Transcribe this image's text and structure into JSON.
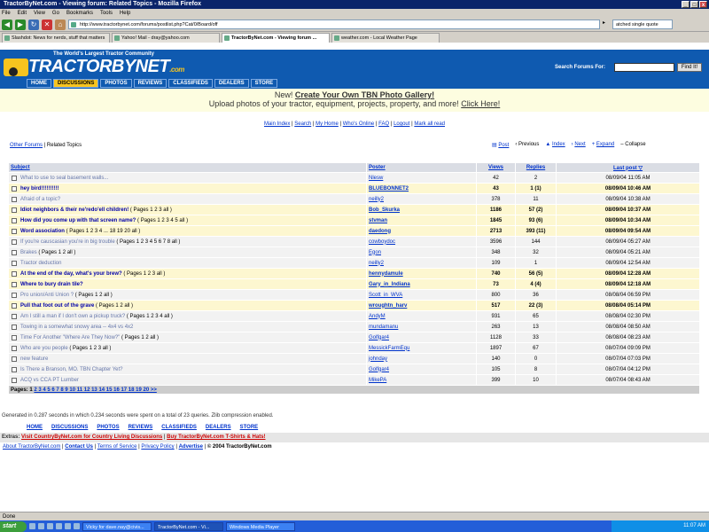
{
  "window": {
    "title": "TractorByNet.com - Viewing forum: Related Topics - Mozilla Firefox"
  },
  "menu": [
    "File",
    "Edit",
    "View",
    "Go",
    "Bookmarks",
    "Tools",
    "Help"
  ],
  "browser": {
    "url": "http://www.tractorbynet.com/forums/postlist.php?Cat/0/Board/off",
    "search": "atched single quote"
  },
  "tabs": [
    "Slashdot: News for nerds, stuff that matters",
    "Yahoo! Mail - dray@yahoo.com",
    "TractorByNet.com - Viewing forum ...",
    "weather.com - Local Weather Page"
  ],
  "site": {
    "slogan": "The World's Largest Tractor Community",
    "logo": "TRACTORBYNET",
    ".com": ".com",
    "search_label": "Search Forums For:",
    "find_btn": "Find It!",
    "nav": [
      "HOME",
      "DISCUSSIONS",
      "PHOTOS",
      "REVIEWS",
      "CLASSIFIEDS",
      "DEALERS",
      "STORE"
    ]
  },
  "promo": {
    "new": "New!",
    "headline": "Create Your Own TBN Photo Gallery!",
    "line2": "Upload photos of your tractor, equipment, projects, property, and more!",
    "click": "Click Here!"
  },
  "toplinks": [
    "Main Index",
    "Search",
    "My Home",
    "Who's Online",
    "FAQ",
    "Logout",
    "Mark all read"
  ],
  "crumb": {
    "other": "Other Forums",
    "current": "Related Topics"
  },
  "topicnav": [
    "Post",
    "Previous",
    "Index",
    "Next",
    "Expand",
    "Collapse"
  ],
  "columns": {
    "subject": "Subject",
    "poster": "Poster",
    "views": "Views",
    "replies": "Replies",
    "lastpost": "Last post ▽"
  },
  "rows": [
    {
      "s": "What to use to seal basement walls...",
      "pages": "",
      "p": "Nlesw",
      "v": "42",
      "r": "2",
      "t": "08/09/04 11:05 AM",
      "hot": false
    },
    {
      "s": "hey bird!!!!!!!!!!",
      "pages": "",
      "p": "BLUEBONNET2",
      "v": "43",
      "r": "1 (1)",
      "t": "08/09/04 10:46 AM",
      "hot": true
    },
    {
      "s": "Afraid of a topic?",
      "pages": "",
      "p": "neilly2",
      "v": "378",
      "r": "11",
      "t": "08/09/04 10:38 AM",
      "hot": false
    },
    {
      "s": "Idiot neighbors & their ne'redo'ell children!",
      "pages": "( Pages 1 2 3 all )",
      "p": "Bob_Skurka",
      "v": "1186",
      "r": "57 (2)",
      "t": "08/09/04 10:37 AM",
      "hot": true
    },
    {
      "s": "How did you come up with that screen name?",
      "pages": "( Pages 1 2 3 4 5 all )",
      "p": "stvman",
      "v": "1845",
      "r": "93 (6)",
      "t": "08/09/04 10:34 AM",
      "hot": true
    },
    {
      "s": "Word association",
      "pages": "( Pages 1 2 3 4 ... 18 19 20 all )",
      "p": "daedong",
      "v": "2713",
      "r": "393 (11)",
      "t": "08/09/04 09:54 AM",
      "hot": true
    },
    {
      "s": "If you're causcasian you're in big trouble",
      "pages": "( Pages 1 2 3 4 5 6 7 8 all )",
      "p": "cowboydoc",
      "v": "3596",
      "r": "144",
      "t": "08/09/04 05:27 AM",
      "hot": false
    },
    {
      "s": "Brakes",
      "pages": "( Pages 1 2 all )",
      "p": "Egon",
      "v": "348",
      "r": "32",
      "t": "08/09/04 05:21 AM",
      "hot": false
    },
    {
      "s": "Tractor deduction",
      "pages": "",
      "p": "neilly2",
      "v": "109",
      "r": "1",
      "t": "08/09/04 12:54 AM",
      "hot": false
    },
    {
      "s": "At the end of the day, what's your brew?",
      "pages": "( Pages 1 2 3 all )",
      "p": "hennydamule",
      "v": "740",
      "r": "56 (5)",
      "t": "08/09/04 12:28 AM",
      "hot": true
    },
    {
      "s": "Where to bury drain tile?",
      "pages": "",
      "p": "Gary_in_Indiana",
      "v": "73",
      "r": "4 (4)",
      "t": "08/09/04 12:18 AM",
      "hot": true
    },
    {
      "s": "Pro union/Anti Union ?",
      "pages": "( Pages 1 2 all )",
      "p": "Scott_in_WVA",
      "v": "800",
      "r": "36",
      "t": "08/08/04 06:59 PM",
      "hot": false
    },
    {
      "s": "Pull that foot out of the grave",
      "pages": "( Pages 1 2 all )",
      "p": "wroughtn_harv",
      "v": "517",
      "r": "22 (3)",
      "t": "08/08/04 05:14 PM",
      "hot": true
    },
    {
      "s": "Am I still a man if I don't own a pickup truck?",
      "pages": "( Pages 1 2 3 4 all )",
      "p": "AndyM",
      "v": "931",
      "r": "65",
      "t": "08/08/04 02:30 PM",
      "hot": false
    },
    {
      "s": "Towing in a somewhat snowy area -- 4x4 vs 4x2",
      "pages": "",
      "p": "mundamanu",
      "v": "263",
      "r": "13",
      "t": "08/08/04 08:50 AM",
      "hot": false
    },
    {
      "s": "Time For Another \"Where Are They Now?\"",
      "pages": "( Pages 1 2 all )",
      "p": "Golfgar4",
      "v": "1128",
      "r": "33",
      "t": "08/08/04 08:23 AM",
      "hot": false
    },
    {
      "s": "Who are you people",
      "pages": "( Pages 1 2 3 all )",
      "p": "MessickFarmEqu",
      "v": "1897",
      "r": "67",
      "t": "08/07/04 09:09 PM",
      "hot": false
    },
    {
      "s": "new feature",
      "pages": "",
      "p": "johnday",
      "v": "140",
      "r": "0",
      "t": "08/07/04 07:03 PM",
      "hot": false
    },
    {
      "s": "Is There a Branson, MO. TBN Chapter Yet?",
      "pages": "",
      "p": "Golfgar4",
      "v": "105",
      "r": "8",
      "t": "08/07/04 04:12 PM",
      "hot": false
    },
    {
      "s": "ACQ vs CCA PT Lumber",
      "pages": "",
      "p": "MikePA",
      "v": "399",
      "r": "10",
      "t": "08/07/04 08:43 AM",
      "hot": false
    }
  ],
  "pagination": {
    "label": "Pages:",
    "current": "1",
    "pages": "2 3 4 5 6 7 8 9 10 11 12 13 14 15 16 17 18 19 20 >>"
  },
  "gen": "Generated in 0.287 seconds in which 0.234 seconds were spent on a total of 23 queries. Zlib compression enabled.",
  "footnav": [
    "HOME",
    "DISCUSSIONS",
    "PHOTOS",
    "REVIEWS",
    "CLASSIFIEDS",
    "DEALERS",
    "STORE"
  ],
  "extras": {
    "label": "Extras:",
    "a1": "Visit CountryByNet.com for Country Living Discussions",
    "a2": "Buy TractorByNet.com T-Shirts & Hats!"
  },
  "legal": {
    "about": "About TractorByNet.com",
    "contact": "Contact Us",
    "terms": "Terms of Service",
    "privacy": "Privacy Policy",
    "advertise": "Advertise",
    "copy": "© 2004 TractorByNet.com"
  },
  "status": "Done",
  "taskbar": {
    "start": "start",
    "tasks": [
      "Vicky for dave.nay@civis...",
      "TractorByNet.com - Vi...",
      "Windows Media Player"
    ],
    "time": "11:07 AM"
  }
}
